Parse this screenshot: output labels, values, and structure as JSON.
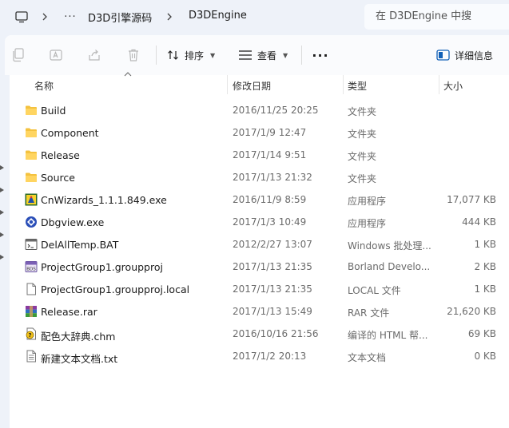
{
  "address_bar": {
    "crumbs": [
      "D3D引擎源码",
      "D3DEngine"
    ],
    "overflow_label": "···",
    "search_placeholder": "在 D3DEngine 中搜"
  },
  "toolbar": {
    "sort_label": "排序",
    "view_label": "查看",
    "more_label": "···",
    "details_label": "详细信息"
  },
  "columns": {
    "name": "名称",
    "date": "修改日期",
    "type": "类型",
    "size": "大小"
  },
  "files": [
    {
      "name": "Build",
      "date": "2016/11/25 20:25",
      "type": "文件夹",
      "size": "",
      "icon": "folder-icon"
    },
    {
      "name": "Component",
      "date": "2017/1/9 12:47",
      "type": "文件夹",
      "size": "",
      "icon": "folder-icon"
    },
    {
      "name": "Release",
      "date": "2017/1/14 9:51",
      "type": "文件夹",
      "size": "",
      "icon": "folder-icon"
    },
    {
      "name": "Source",
      "date": "2017/1/13 21:32",
      "type": "文件夹",
      "size": "",
      "icon": "folder-icon"
    },
    {
      "name": "CnWizards_1.1.1.849.exe",
      "date": "2016/11/9 8:59",
      "type": "应用程序",
      "size": "17,077 KB",
      "icon": "wizard-exe-icon"
    },
    {
      "name": "Dbgview.exe",
      "date": "2017/1/3 10:49",
      "type": "应用程序",
      "size": "444 KB",
      "icon": "dbgview-exe-icon"
    },
    {
      "name": "DelAllTemp.BAT",
      "date": "2012/2/27 13:07",
      "type": "Windows 批处理...",
      "size": "1 KB",
      "icon": "batch-file-icon"
    },
    {
      "name": "ProjectGroup1.groupproj",
      "date": "2017/1/13 21:35",
      "type": "Borland Develo...",
      "size": "2 KB",
      "icon": "bds-project-icon"
    },
    {
      "name": "ProjectGroup1.groupproj.local",
      "date": "2017/1/13 21:35",
      "type": "LOCAL 文件",
      "size": "1 KB",
      "icon": "blank-file-icon"
    },
    {
      "name": "Release.rar",
      "date": "2017/1/13 15:49",
      "type": "RAR 文件",
      "size": "21,620 KB",
      "icon": "rar-archive-icon"
    },
    {
      "name": "配色大辞典.chm",
      "date": "2016/10/16 21:56",
      "type": "编译的 HTML 帮...",
      "size": "69 KB",
      "icon": "chm-help-icon"
    },
    {
      "name": "新建文本文档.txt",
      "date": "2017/1/2 20:13",
      "type": "文本文档",
      "size": "0 KB",
      "icon": "text-file-icon"
    }
  ]
}
